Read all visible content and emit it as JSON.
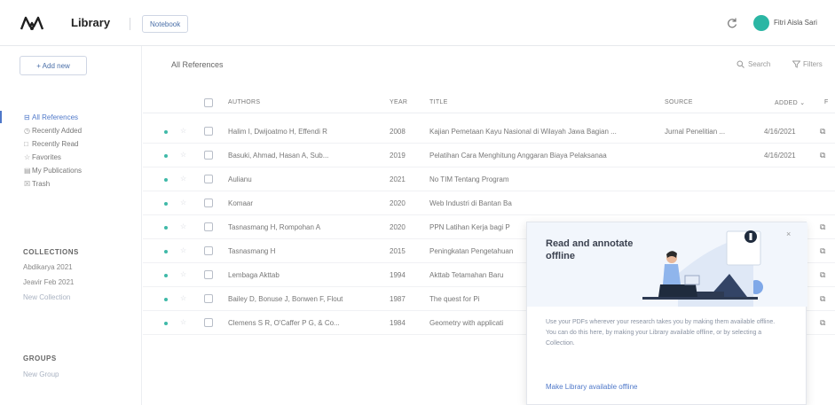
{
  "header": {
    "app_title": "Library",
    "notebook_label": "Notebook",
    "user_name": "Fitri Aisla Sari"
  },
  "sidebar": {
    "add_new_label": "+ Add new",
    "nav_items": [
      {
        "icon": "⊟",
        "label": "All References",
        "active": true
      },
      {
        "icon": "◷",
        "label": "Recently Added",
        "active": false
      },
      {
        "icon": "□",
        "label": "Recently Read",
        "active": false
      },
      {
        "icon": "☆",
        "label": "Favorites",
        "active": false
      },
      {
        "icon": "▤",
        "label": "My Publications",
        "active": false
      },
      {
        "icon": "☒",
        "label": "Trash",
        "active": false
      }
    ],
    "collections_heading": "COLLECTIONS",
    "collections": [
      "Abdikarya 2021",
      "Jeavir Feb 2021"
    ],
    "new_collection_label": "New Collection",
    "groups_heading": "GROUPS",
    "new_group_label": "New Group"
  },
  "main": {
    "title": "All References",
    "search_label": "Search",
    "filter_label": "Filters",
    "columns": {
      "authors": "AUTHORS",
      "year": "YEAR",
      "title": "TITLE",
      "source": "SOURCE",
      "added": "ADDED ⌄",
      "file": "F"
    },
    "rows": [
      {
        "authors": "Halim I, Dwijoatmo H, Effendi R",
        "year": "2008",
        "title": "Kajian Pemetaan Kayu Nasional di Wilayah Jawa Bagian ...",
        "source": "Jurnal Penelitian ...",
        "added": "4/16/2021",
        "has_pdf": true
      },
      {
        "authors": "Basuki, Ahmad, Hasan A, Sub...",
        "year": "2019",
        "title": "Pelatihan Cara Menghitung Anggaran Biaya Pelaksanaa",
        "source": "",
        "added": "4/16/2021",
        "has_pdf": true
      },
      {
        "authors": "Aulianu",
        "year": "2021",
        "title": "No TIM Tentang Program",
        "source": "",
        "added": "",
        "has_pdf": false
      },
      {
        "authors": "Komaar",
        "year": "2020",
        "title": "Web Industri di Bantan Ba",
        "source": "",
        "added": "",
        "has_pdf": false
      },
      {
        "authors": "Tasnasmang H, Rompohan A",
        "year": "2020",
        "title": "PPN Latihan Kerja bagi P",
        "source": "",
        "added": "",
        "has_pdf": true
      },
      {
        "authors": "Tasnasmang H",
        "year": "2015",
        "title": "Peningkatan Pengetahuan",
        "source": "",
        "added": "",
        "has_pdf": true
      },
      {
        "authors": "Lembaga Akttab",
        "year": "1994",
        "title": "Akttab Tetamahan Baru",
        "source": "",
        "added": "",
        "has_pdf": true
      },
      {
        "authors": "Bailey D, Bonuse J, Bonwen F, Flout",
        "year": "1987",
        "title": "The quest for Pi",
        "source": "",
        "added": "",
        "has_pdf": true
      },
      {
        "authors": "Clemens S R, O'Caffer P G, & Co...",
        "year": "1984",
        "title": "Geometry with applicati",
        "source": "",
        "added": "",
        "has_pdf": true
      }
    ]
  },
  "popup": {
    "close_label": "×",
    "title": "Read and annotate offline",
    "body": "Use your PDFs wherever your research takes you by making them available offline. You can do this here, by making your Library available offline, or by selecting a Collection.",
    "link_label": "Make Library available offline"
  },
  "colors": {
    "accent": "#4f78c9",
    "teal": "#2bb6a4",
    "illustration_bg": "#f2f6fc"
  }
}
